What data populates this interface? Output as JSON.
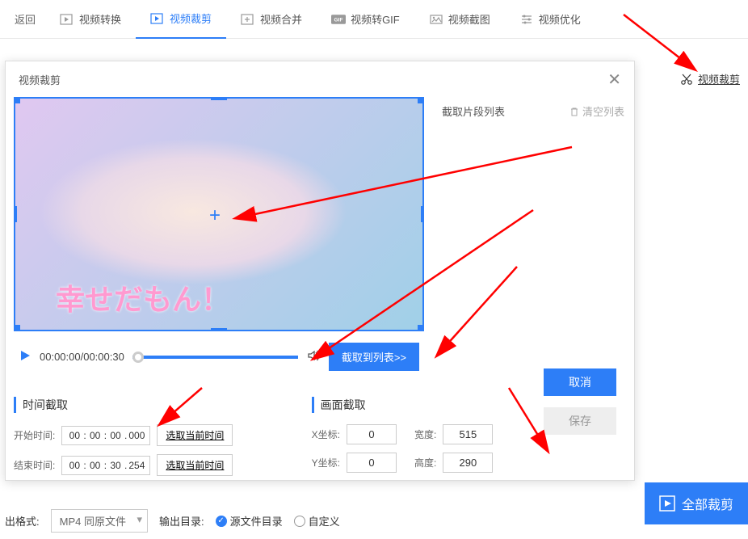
{
  "topbar": {
    "back": "返回",
    "tabs": [
      {
        "label": "视频转换",
        "icon": "convert-icon"
      },
      {
        "label": "视频裁剪",
        "icon": "crop-icon",
        "active": true
      },
      {
        "label": "视频合并",
        "icon": "merge-icon"
      },
      {
        "label": "视频转GIF",
        "icon": "gif-icon"
      },
      {
        "label": "视频截图",
        "icon": "screenshot-icon"
      },
      {
        "label": "视频优化",
        "icon": "optimize-icon"
      }
    ]
  },
  "sideLink": {
    "label": "视频裁剪"
  },
  "dialog": {
    "title": "视频裁剪",
    "listHeader": "截取片段列表",
    "clearList": "清空列表",
    "previewCaption": "幸せだもん！",
    "timeDisplay": "00:00:00/00:00:30",
    "captureBtn": "截取到列表>>",
    "timeSection": "时间截取",
    "startLabel": "开始时间:",
    "endLabel": "结束时间:",
    "startTime": {
      "h": "00",
      "m": "00",
      "s": "00",
      "ms": "000"
    },
    "endTime": {
      "h": "00",
      "m": "00",
      "s": "30",
      "ms": "254"
    },
    "pickBtn": "选取当前时间",
    "frameSection": "画面截取",
    "xLabel": "X坐标:",
    "yLabel": "Y坐标:",
    "wLabel": "宽度:",
    "hLabel": "高度:",
    "x": "0",
    "y": "0",
    "w": "515",
    "h": "290",
    "cancel": "取消",
    "save": "保存"
  },
  "bottom": {
    "formatLabel": "出格式:",
    "formatValue": "MP4 同原文件",
    "dirLabel": "输出目录:",
    "opt1": "源文件目录",
    "opt2": "自定义",
    "allCrop": "全部裁剪"
  }
}
